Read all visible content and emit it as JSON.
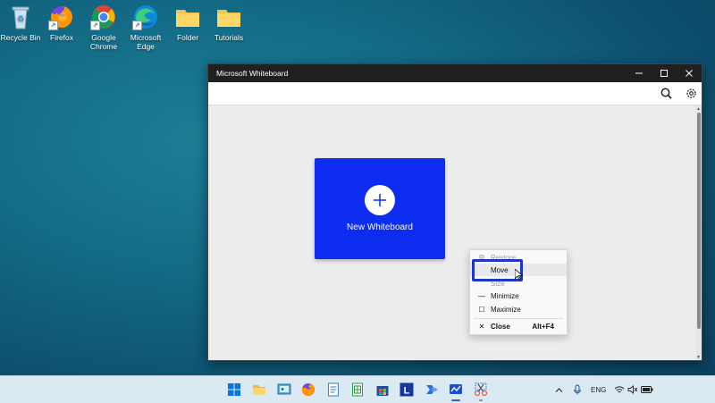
{
  "desktop": {
    "icons": [
      {
        "label": "Recycle Bin"
      },
      {
        "label": "Firefox"
      },
      {
        "label": "Google Chrome"
      },
      {
        "label": "Microsoft Edge"
      },
      {
        "label": "Folder"
      },
      {
        "label": "Tutorials"
      }
    ]
  },
  "window": {
    "title": "Microsoft Whiteboard",
    "new_whiteboard_label": "New Whiteboard"
  },
  "context_menu": {
    "items": [
      {
        "label": "Restore",
        "shortcut": ""
      },
      {
        "label": "Move",
        "shortcut": ""
      },
      {
        "label": "Size",
        "shortcut": ""
      },
      {
        "label": "Minimize",
        "shortcut": ""
      },
      {
        "label": "Maximize",
        "shortcut": ""
      },
      {
        "label": "Close",
        "shortcut": "Alt+F4"
      }
    ]
  },
  "taskbar": {
    "language": "ENG"
  },
  "colors": {
    "whiteboard_blue": "#0c2cf0",
    "highlight_blue": "#2036c8",
    "titlebar": "#202020"
  }
}
